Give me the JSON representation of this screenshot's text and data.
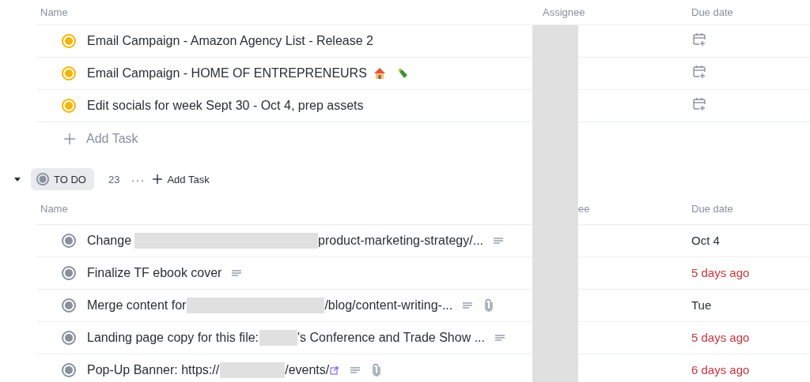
{
  "sections": [
    {
      "status": {
        "color": "#f5b400"
      },
      "columns": [
        "Name",
        "Assignee",
        "Due date"
      ],
      "tasks": [
        {
          "parts": [
            "Email Campaign - Amazon Agency List - Release 2"
          ],
          "due": {
            "kind": "button"
          }
        },
        {
          "parts": [
            "Email Campaign - HOME OF ENTREPRENEURS"
          ],
          "icons": [
            {
              "kind": "house"
            },
            {
              "kind": "bottle"
            }
          ],
          "due": {
            "kind": "button"
          }
        },
        {
          "parts": [
            "Edit socials for week Sept 30 - Oct 4, prep assets"
          ],
          "due": {
            "kind": "button"
          }
        }
      ],
      "add_task": "Add Task"
    },
    {
      "status": {
        "label": "TO DO",
        "color": "#87909e"
      },
      "expanded": true,
      "count": "23",
      "more": "···",
      "header_add_task": "Add Task",
      "columns": [
        "Name",
        "ee",
        "Due date"
      ],
      "tasks": [
        {
          "parts": [
            "Change",
            "product-marketing-strategy/..."
          ],
          "icons": [
            {
              "kind": "description"
            }
          ],
          "due": {
            "kind": "date",
            "text": "Oct 4",
            "overdue": false
          }
        },
        {
          "parts": [
            "Finalize TF ebook cover"
          ],
          "icons": [
            {
              "kind": "description"
            }
          ],
          "due": {
            "kind": "date",
            "text": "5 days ago",
            "overdue": true
          }
        },
        {
          "parts": [
            "Merge content for",
            "/blog/content-writing-..."
          ],
          "icons": [
            {
              "kind": "description"
            },
            {
              "kind": "attachment"
            }
          ],
          "due": {
            "kind": "date",
            "text": "Tue",
            "overdue": false
          }
        },
        {
          "parts": [
            "Landing page copy for this file:",
            "'s Conference and Trade Show ..."
          ],
          "icons": [
            {
              "kind": "description"
            }
          ],
          "due": {
            "kind": "date",
            "text": "5 days ago",
            "overdue": true
          }
        },
        {
          "parts": [
            "Pop-Up Banner: https://",
            "/events/"
          ],
          "icons": [
            {
              "kind": "link"
            },
            {
              "kind": "description"
            },
            {
              "kind": "attachment"
            }
          ],
          "due": {
            "kind": "date",
            "text": "6 days ago",
            "overdue": true
          }
        }
      ]
    }
  ]
}
